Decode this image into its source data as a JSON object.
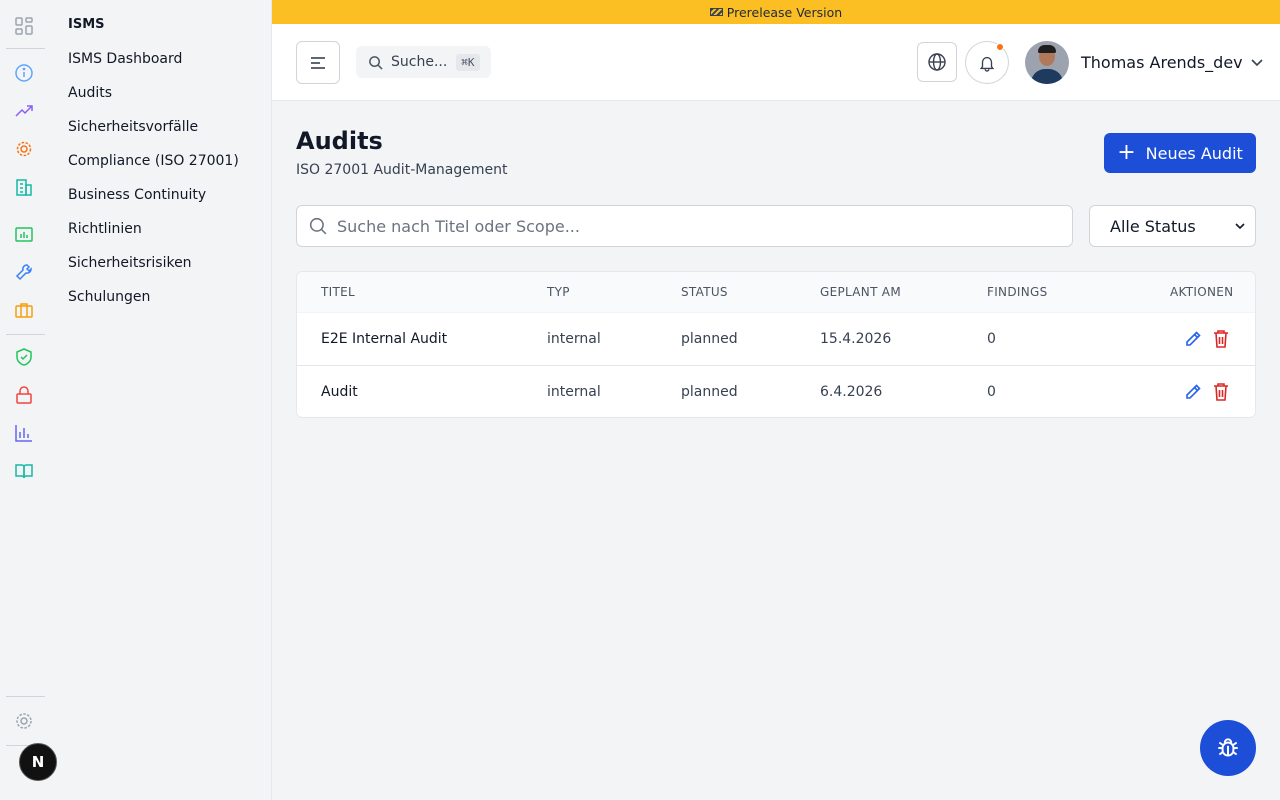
{
  "banner": {
    "text": "Prerelease Version"
  },
  "rail": {
    "icons": [
      "apps-grid-icon",
      "info-icon",
      "trending-up-icon",
      "gear-orange-icon",
      "building-icon",
      "chart-frame-icon",
      "wrench-icon",
      "briefcase-icon",
      "shield-check-icon",
      "lock-icon",
      "bar-chart-icon",
      "book-icon",
      "settings-icon"
    ],
    "colors": {
      "info": "#60a5fa",
      "trend": "#8b5cf6",
      "gear": "#f97316",
      "building": "#14b8a6",
      "chart": "#22c55e",
      "wrench": "#3b82f6",
      "briefcase": "#f59e0b",
      "shield": "#22c55e",
      "lock": "#ef4444",
      "bars": "#6366f1",
      "book": "#14b8a6"
    }
  },
  "nav": {
    "title": "ISMS",
    "items": [
      {
        "label": "ISMS Dashboard"
      },
      {
        "label": "Audits"
      },
      {
        "label": "Sicherheitsvorfälle"
      },
      {
        "label": "Compliance (ISO 27001)"
      },
      {
        "label": "Business Continuity"
      },
      {
        "label": "Richtlinien"
      },
      {
        "label": "Sicherheitsrisiken"
      },
      {
        "label": "Schulungen"
      }
    ]
  },
  "header": {
    "search_label": "Suche...",
    "search_shortcut": "⌘K",
    "user_name": "Thomas Arends_dev"
  },
  "page": {
    "title": "Audits",
    "subtitle": "ISO 27001 Audit-Management",
    "new_button": "Neues Audit",
    "search_placeholder": "Suche nach Titel oder Scope...",
    "status_filter": "Alle Status"
  },
  "table": {
    "columns": [
      "TITEL",
      "TYP",
      "STATUS",
      "GEPLANT AM",
      "FINDINGS",
      "AKTIONEN"
    ],
    "rows": [
      {
        "title": "E2E Internal Audit",
        "type": "internal",
        "status": "planned",
        "date": "15.4.2026",
        "findings": "0"
      },
      {
        "title": "Audit",
        "type": "internal",
        "status": "planned",
        "date": "6.4.2026",
        "findings": "0"
      }
    ]
  },
  "badge": {
    "text": "N"
  },
  "colors": {
    "accent": "#1d4ed8",
    "banner": "#fbbf24",
    "danger": "#dc2626",
    "notification": "#f97316"
  }
}
